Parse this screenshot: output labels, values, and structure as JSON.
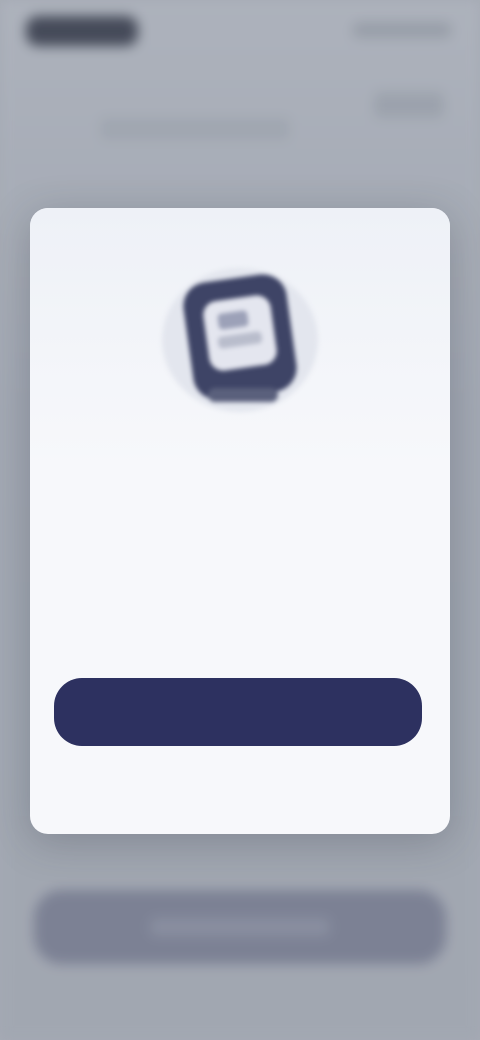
{
  "background": {
    "bottom_button_label": ""
  },
  "modal": {
    "icon": "device-illustration-icon",
    "title": "",
    "description": "",
    "primary_button_label": "",
    "secondary_link_label": ""
  },
  "colors": {
    "primary": "#2d3160",
    "modal_bg": "#f7f8fb",
    "backdrop": "#aeb3bc"
  }
}
